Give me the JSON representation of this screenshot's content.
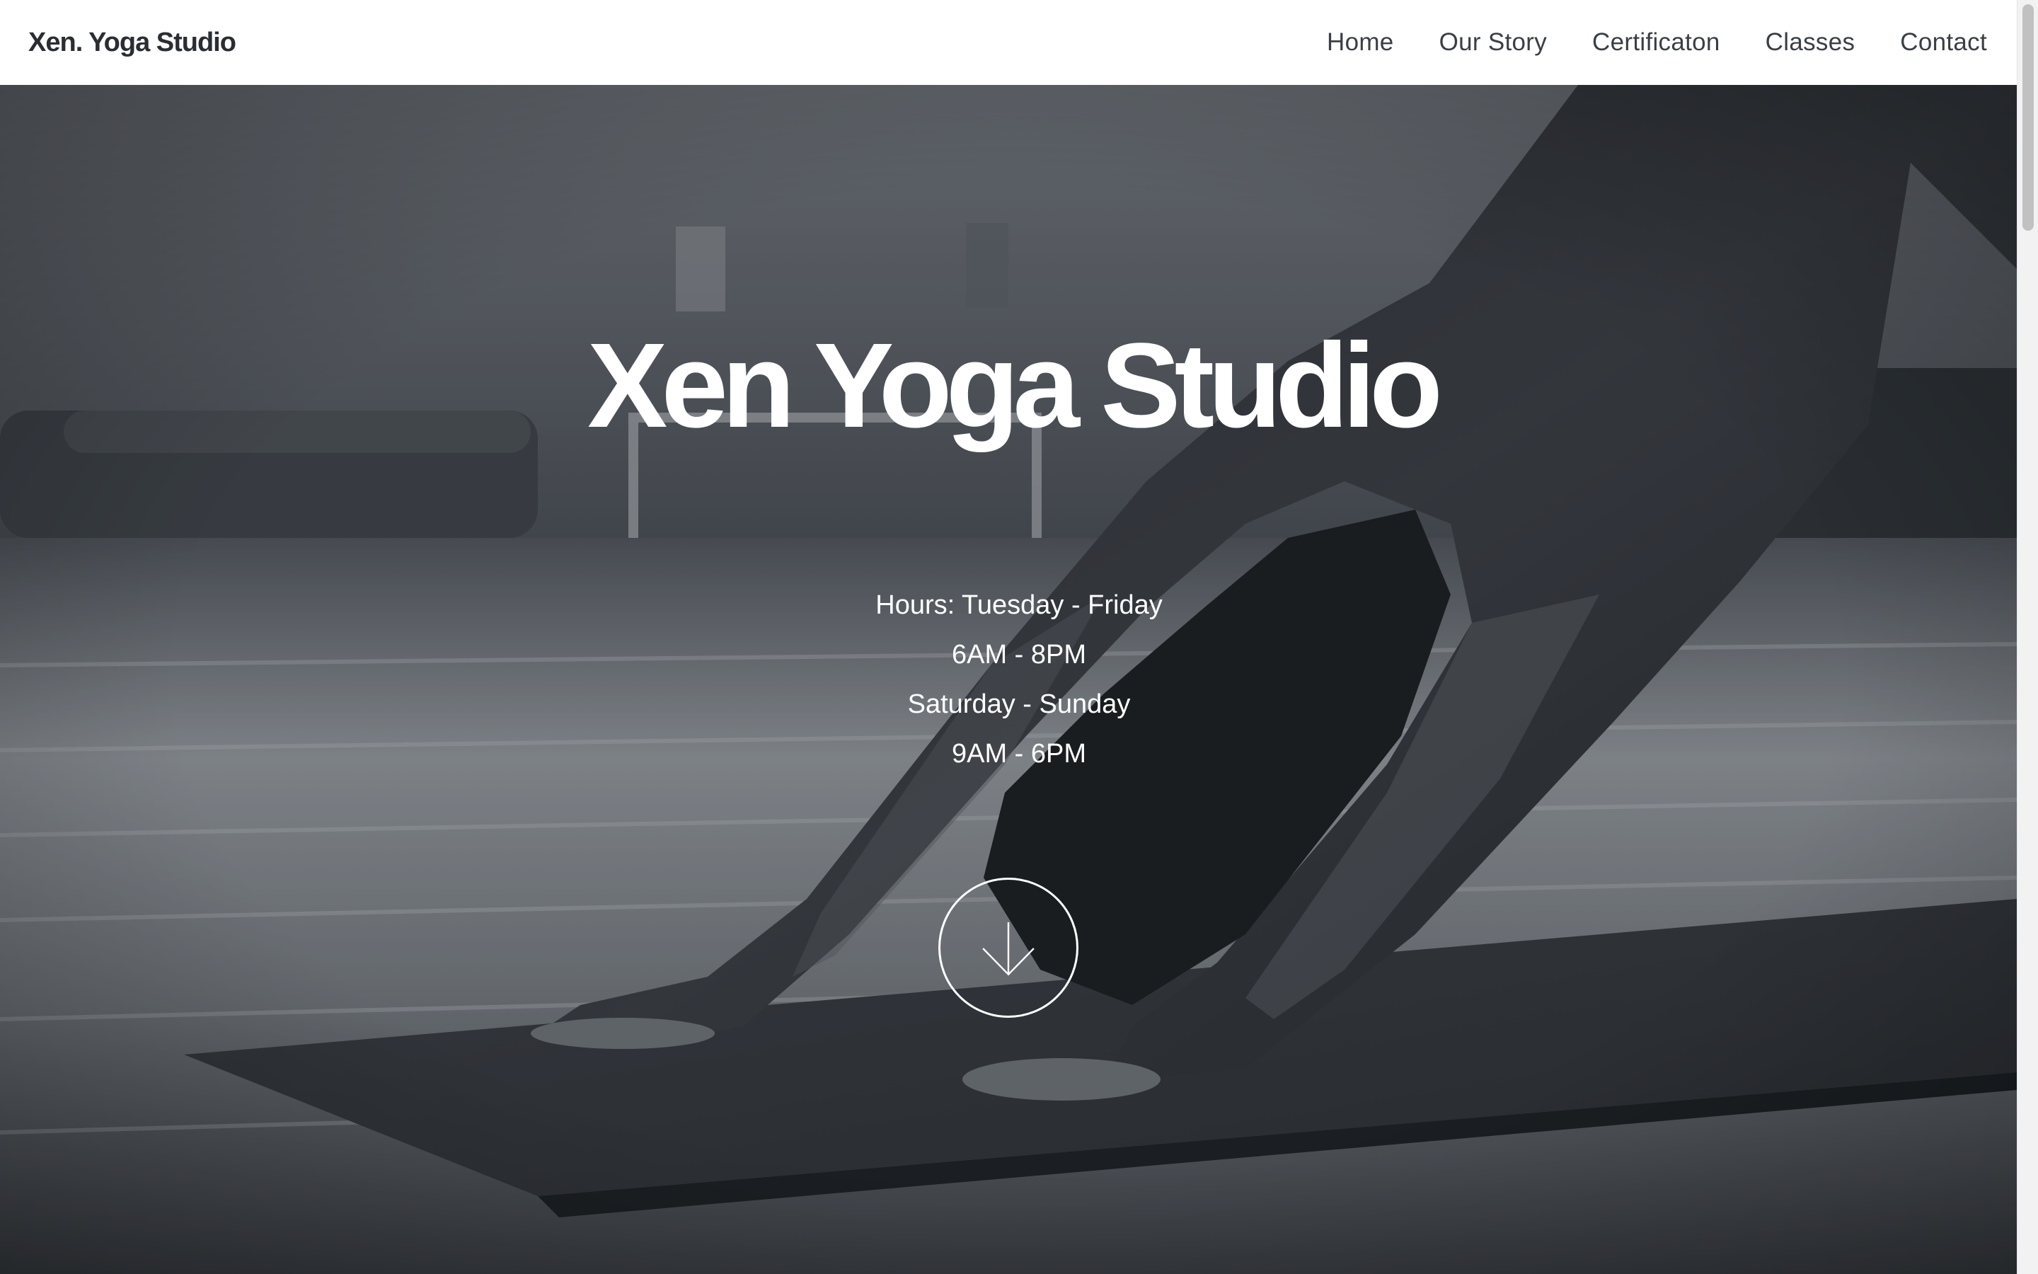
{
  "navbar": {
    "brand": "Xen. Yoga Studio",
    "links": [
      {
        "label": "Home"
      },
      {
        "label": "Our Story"
      },
      {
        "label": "Certificaton"
      },
      {
        "label": "Classes"
      },
      {
        "label": "Contact"
      }
    ]
  },
  "hero": {
    "title": "Xen Yoga Studio",
    "hours": [
      "Hours: Tuesday - Friday",
      "6AM - 8PM",
      "Saturday - Sunday",
      "9AM - 6PM"
    ],
    "scroll_icon": "arrow-down-icon",
    "image": "black-and-white photo of a person in downward dog pose on a yoga mat"
  },
  "colors": {
    "navbar_bg": "#ffffff",
    "brand_text": "#2a2e33",
    "nav_text": "#3a3f45",
    "hero_text": "#ffffff"
  }
}
